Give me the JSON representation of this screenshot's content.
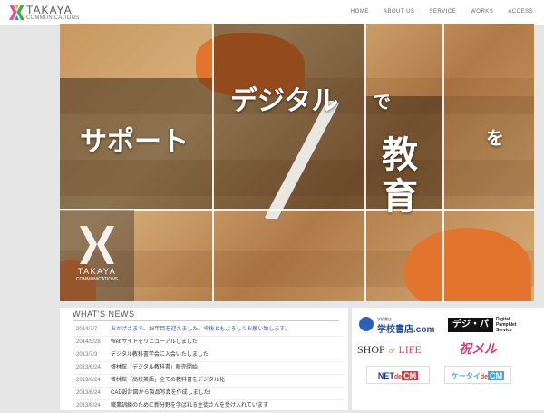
{
  "header": {
    "logo_name": "TAKAYA",
    "logo_sub": "COMMUNICATIONS",
    "nav": [
      "HOME",
      "ABOUT US",
      "SERVICE",
      "WORKS",
      "ACCESS"
    ]
  },
  "hero": {
    "text_support": "サポート",
    "text_digital": "デジタル",
    "text_de": "で",
    "text_kyo": "教",
    "text_iku": "育",
    "text_wo": "を"
  },
  "badge": {
    "name": "TAKAYA",
    "sub": "COMMUNICATIONS"
  },
  "news": {
    "title": "WHAT'S NEWS",
    "items": [
      {
        "date": "2014/7/7",
        "text": "おかげさまで、18年目を迎えました。今後ともよろしくお願い致します。",
        "highlight": true
      },
      {
        "date": "2014/5/28",
        "text": "Webサイトをリニューアルしました"
      },
      {
        "date": "2013/7/3",
        "text": "デジタル教科書学会に入会いたしました"
      },
      {
        "date": "2013/6/24",
        "text": "啓林館「デジタル教科書」販売開始！"
      },
      {
        "date": "2013/6/24",
        "text": "啓林館「高校英語」全ての教科書をデジタル化"
      },
      {
        "date": "2013/6/24",
        "text": "CAD設計図から製品写真を作成しました!"
      },
      {
        "date": "2013/6/24",
        "text": "職業訓練のために新分野を学ばれる生徒さんを受け入れています"
      }
    ]
  },
  "banners": {
    "gakkou_small": "学校書店",
    "gakkou_main": "学校書店.com",
    "digipan_main": "デジ・パン",
    "digipan_sub1": "Digital",
    "digipan_sub2": "Pamphlet",
    "digipan_sub3": "Service",
    "shop_main": "SHOP",
    "shop_of": "of",
    "shop_life": "LIFE",
    "iwaimeru": "祝メル",
    "netde_a": "NET",
    "netde_b": "de",
    "netde_c": "CM",
    "keitai_a": "ケータイ",
    "keitai_b": "de",
    "keitai_c": "CM"
  }
}
